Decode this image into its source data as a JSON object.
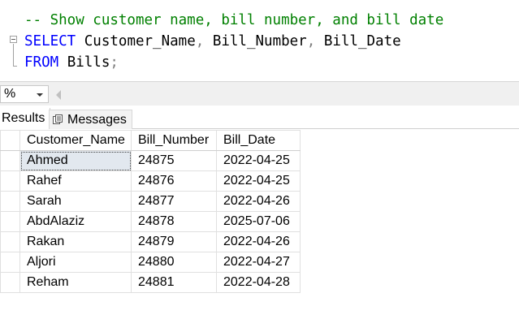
{
  "editor": {
    "comment": "-- Show customer name, bill number, and bill date",
    "line2": {
      "keyword": "SELECT",
      "col1": "Customer_Name",
      "sep1": ",",
      "col2": "Bill_Number",
      "sep2": ",",
      "col3": "Bill_Date"
    },
    "line3": {
      "keyword": "FROM",
      "table": "Bills",
      "terminator": ";"
    }
  },
  "zoom": {
    "value": "%"
  },
  "tabs": {
    "results": "Results",
    "messages": "Messages"
  },
  "grid": {
    "columns": [
      "Customer_Name",
      "Bill_Number",
      "Bill_Date"
    ],
    "rows": [
      [
        "Ahmed",
        "24875",
        "2022-04-25"
      ],
      [
        "Rahef",
        "24876",
        "2022-04-25"
      ],
      [
        "Sarah",
        "24877",
        "2022-04-26"
      ],
      [
        "AbdAlaziz",
        "24878",
        "2025-07-06"
      ],
      [
        "Rakan",
        "24879",
        "2022-04-26"
      ],
      [
        "Aljori",
        "24880",
        "2022-04-27"
      ],
      [
        "Reham",
        "24881",
        "2022-04-28"
      ]
    ]
  },
  "colors": {
    "comment": "#008000",
    "keyword": "#0000ff",
    "selected_cell": "#e2e8ef"
  },
  "icons": {
    "messages_tab": "messages-icon",
    "fold": "collapse-icon"
  }
}
